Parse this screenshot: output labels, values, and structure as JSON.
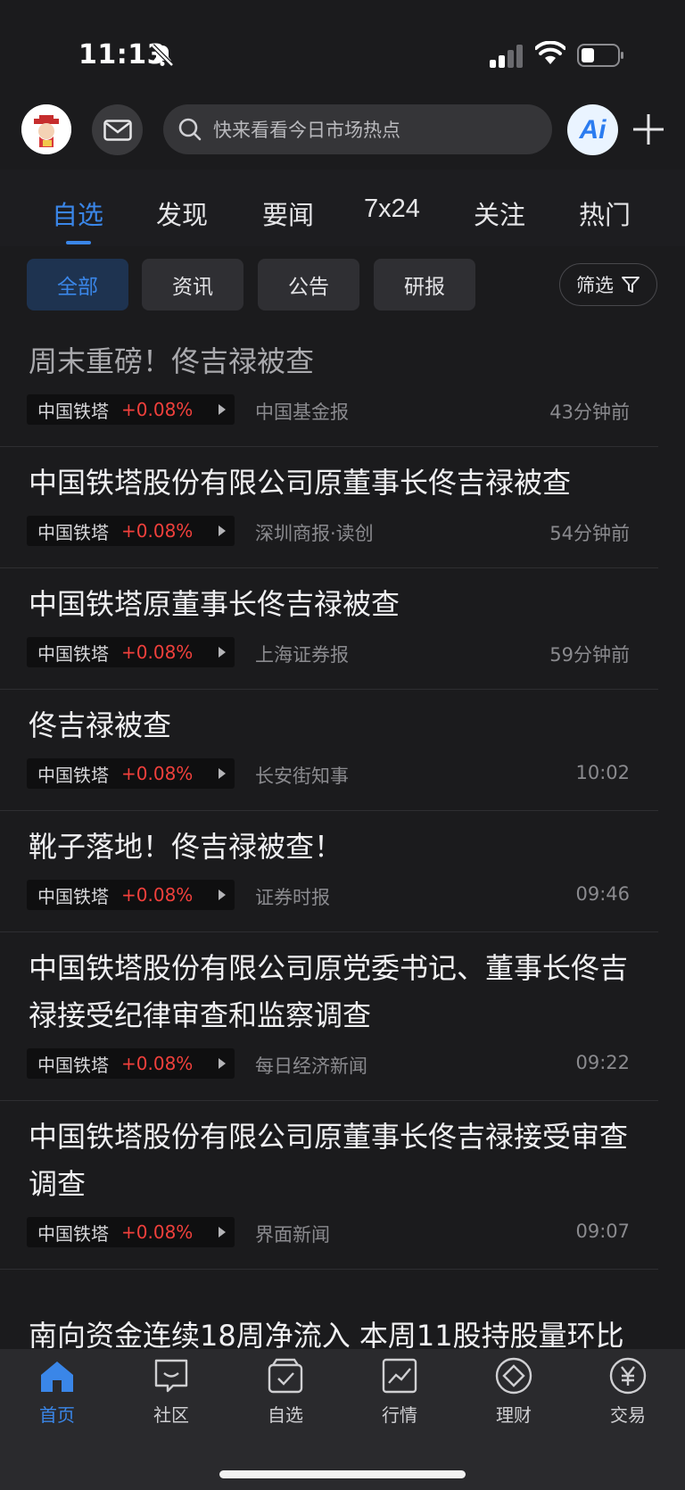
{
  "status_bar": {
    "time": "11:13"
  },
  "header": {
    "search_placeholder": "快来看看今日市场热点",
    "ai_label": "Ai"
  },
  "tabs": [
    {
      "label": "自选",
      "active": true
    },
    {
      "label": "发现"
    },
    {
      "label": "要闻"
    },
    {
      "label": "7x24"
    },
    {
      "label": "关注"
    },
    {
      "label": "热门"
    }
  ],
  "chips": [
    {
      "label": "全部",
      "active": true
    },
    {
      "label": "资讯"
    },
    {
      "label": "公告"
    },
    {
      "label": "研报"
    }
  ],
  "filter_label": "筛选",
  "news": [
    {
      "title": "周末重磅！佟吉禄被查",
      "stock": "中国铁塔",
      "change": "+0.08%",
      "source": "中国基金报",
      "time": "43分钟前",
      "read": true
    },
    {
      "title": "中国铁塔股份有限公司原董事长佟吉禄被查",
      "stock": "中国铁塔",
      "change": "+0.08%",
      "source": "深圳商报·读创",
      "time": "54分钟前"
    },
    {
      "title": "中国铁塔原董事长佟吉禄被查",
      "stock": "中国铁塔",
      "change": "+0.08%",
      "source": "上海证券报",
      "time": "59分钟前"
    },
    {
      "title": "佟吉禄被查",
      "stock": "中国铁塔",
      "change": "+0.08%",
      "source": "长安街知事",
      "time": "10:02"
    },
    {
      "title": "靴子落地！佟吉禄被查！",
      "stock": "中国铁塔",
      "change": "+0.08%",
      "source": "证券时报",
      "time": "09:46"
    },
    {
      "title": "中国铁塔股份有限公司原党委书记、董事长佟吉禄接受纪律审查和监察调查",
      "stock": "中国铁塔",
      "change": "+0.08%",
      "source": "每日经济新闻",
      "time": "09:22"
    },
    {
      "title": "中国铁塔股份有限公司原董事长佟吉禄接受审查调查",
      "stock": "中国铁塔",
      "change": "+0.08%",
      "source": "界面新闻",
      "time": "09:07"
    }
  ],
  "partial_title": "南向资金连续18周净流入 本周11股持股量环比",
  "bottom_nav": [
    {
      "label": "首页",
      "icon": "home-icon",
      "active": true
    },
    {
      "label": "社区",
      "icon": "community-icon"
    },
    {
      "label": "自选",
      "icon": "watchlist-icon"
    },
    {
      "label": "行情",
      "icon": "market-icon"
    },
    {
      "label": "理财",
      "icon": "wealth-icon"
    },
    {
      "label": "交易",
      "icon": "trade-icon"
    }
  ],
  "colors": {
    "accent": "#3a86e8",
    "rise": "#f0403c",
    "background": "#1b1b1d"
  }
}
